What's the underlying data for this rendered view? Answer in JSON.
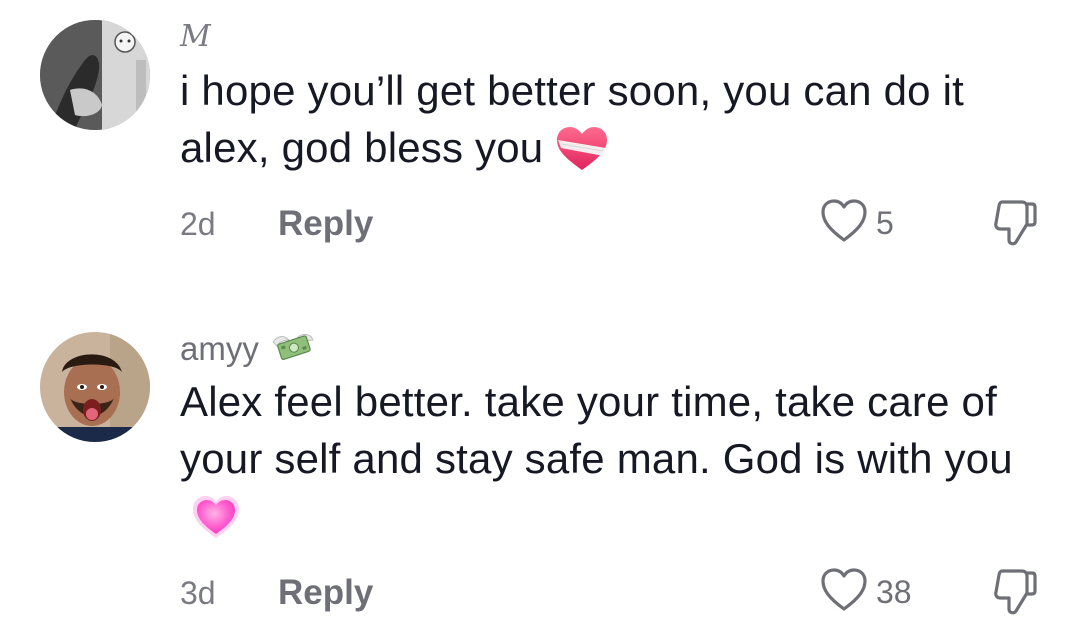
{
  "comments": [
    {
      "username": "M",
      "text": "i hope you’ll get better soon, you can do it alex, god bless you",
      "emoji": "mending-heart-icon",
      "time": "2d",
      "reply_label": "Reply",
      "likes": "5"
    },
    {
      "username": "amyy",
      "username_emoji": "money-with-wings-icon",
      "text": "Alex feel better. take your time, take care of your self and stay safe man. God is with you",
      "emoji": "growing-heart-icon",
      "time": "3d",
      "reply_label": "Reply",
      "likes": "38"
    }
  ],
  "colors": {
    "text": "#161823",
    "muted": "#6f7077",
    "background": "#ffffff"
  }
}
